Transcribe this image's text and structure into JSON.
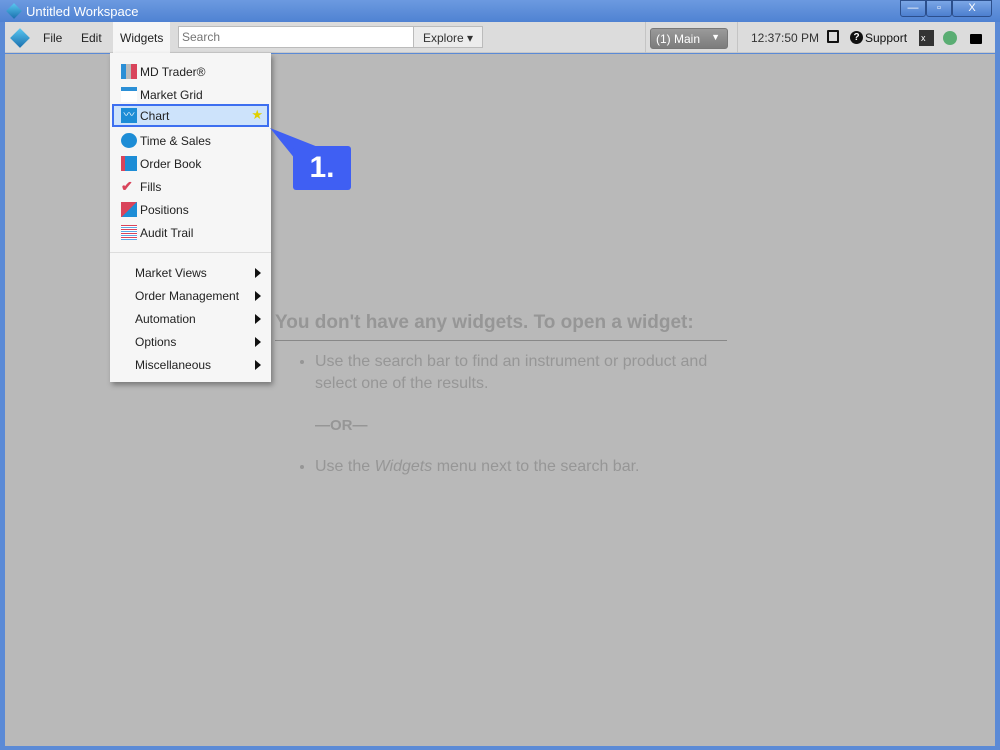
{
  "window": {
    "title": "Untitled Workspace",
    "minimize": "—",
    "restore": "▫",
    "close": "X"
  },
  "toolbar": {
    "menus": [
      "File",
      "Edit",
      "Widgets"
    ],
    "search_placeholder": "Search",
    "explore": "Explore ▾",
    "workspace_select": "(1) Main",
    "workspace_arrow": "▼",
    "time": "12:37:50 PM",
    "support": "Support",
    "status_color": "#5aad73"
  },
  "widgets_menu": {
    "items": [
      {
        "label": "MD Trader®",
        "icon": "md-trader-icon"
      },
      {
        "label": "Market Grid",
        "icon": "market-grid-icon"
      },
      {
        "label": "Chart",
        "icon": "chart-icon",
        "selected": true,
        "favorite": true
      },
      {
        "label": "Time & Sales",
        "icon": "clock-icon"
      },
      {
        "label": "Order Book",
        "icon": "book-icon"
      },
      {
        "label": "Fills",
        "icon": "check-icon"
      },
      {
        "label": "Positions",
        "icon": "positions-icon"
      },
      {
        "label": "Audit Trail",
        "icon": "audit-trail-icon"
      }
    ],
    "submenus": [
      "Market Views",
      "Order Management",
      "Automation",
      "Options",
      "Miscellaneous"
    ]
  },
  "callout": "1.",
  "empty_state": {
    "heading": "You don't have any widgets. To open a widget:",
    "bullet1": "Use the search bar to find an instrument or product and select one of the results.",
    "or": "—OR—",
    "bullet2_pre": "Use the ",
    "bullet2_em": "Widgets",
    "bullet2_post": " menu next to the search bar."
  },
  "colors": {
    "accent": "#3f5ff3",
    "selection": "#cde3fb"
  }
}
